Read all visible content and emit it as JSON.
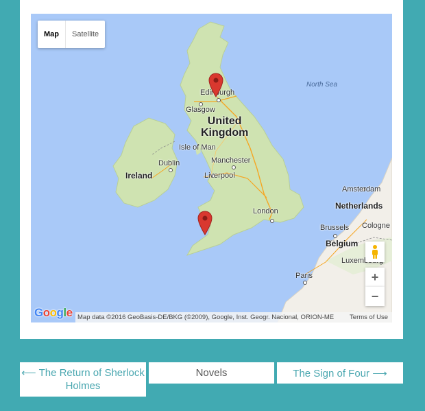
{
  "map": {
    "type_controls": [
      {
        "label": "Map",
        "active": true
      },
      {
        "label": "Satellite",
        "active": false
      }
    ],
    "labels": {
      "north_sea": "North Sea",
      "edinburgh": "Edinburgh",
      "glasgow": "Glasgow",
      "united_kingdom_1": "United",
      "united_kingdom_2": "Kingdom",
      "isle_of_man": "Isle of Man",
      "dublin": "Dublin",
      "ireland": "Ireland",
      "manchester": "Manchester",
      "liverpool": "Liverpool",
      "amsterdam": "Amsterdam",
      "netherlands": "Netherlands",
      "london": "London",
      "brussels": "Brussels",
      "cologne": "Cologne",
      "belgium": "Belgium",
      "luxembourg": "Luxembourg",
      "paris": "Paris"
    },
    "zoom_in": "+",
    "zoom_out": "−",
    "google_logo": "Google",
    "attribution": "Map data ©2016 GeoBasis-DE/BKG (©2009), Google, Inst. Geogr. Nacional, ORION-ME",
    "terms": "Terms of Use",
    "marker_color": "#d9382f"
  },
  "pagination": {
    "prev": "⟵ The Return of Sherlock Holmes",
    "middle": "Novels",
    "next": "The Sign of Four ⟶"
  },
  "colors": {
    "background": "#41aab2",
    "link": "#4aa7b0",
    "water": "#a9c9f8",
    "land": "#f2efe9",
    "green_land": "#cfe3b1"
  }
}
